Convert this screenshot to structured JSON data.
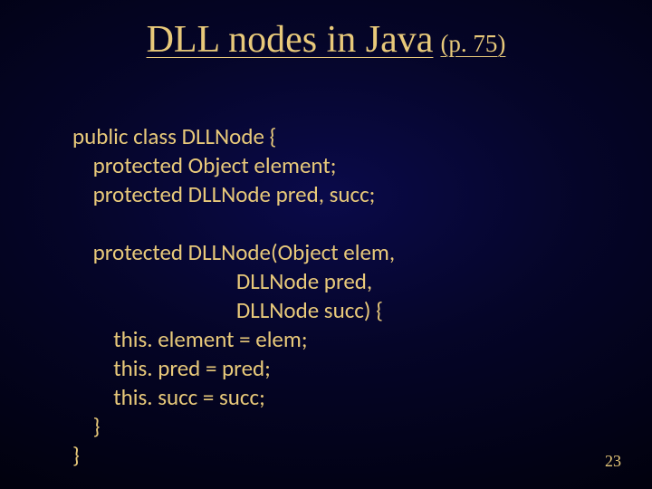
{
  "title": {
    "main": "DLL nodes in Java",
    "sub": "(p. 75)"
  },
  "code": "public class DLLNode {\n    protected Object element;\n    protected DLLNode pred, succ;\n\n    protected DLLNode(Object elem,\n                                DLLNode pred,\n                                DLLNode succ) {\n        this. element = elem;\n        this. pred = pred;\n        this. succ = succ;\n    }\n}",
  "page_number": "23"
}
